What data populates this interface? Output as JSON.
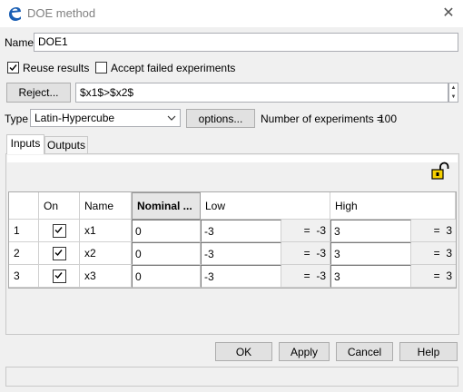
{
  "window": {
    "title": "DOE method",
    "icon": "e-app-icon",
    "close": "close-icon"
  },
  "name_label": "Name",
  "name_value": "DOE1",
  "reuse": {
    "label": "Reuse results",
    "checked": true
  },
  "accept_failed": {
    "label": "Accept failed experiments",
    "checked": false
  },
  "reject_button": "Reject...",
  "reject_expression": "$x1$>$x2$",
  "type_label": "Type",
  "type_value": "Latin-Hypercube",
  "options_button": "options...",
  "num_experiments_label": "Number of experiments =",
  "num_experiments_value": "100",
  "tabs": [
    "Inputs",
    "Outputs"
  ],
  "active_tab": "Inputs",
  "lock_icon": "unlock-icon",
  "table": {
    "headers": {
      "index": "",
      "on": "On",
      "name": "Name",
      "nominal": "Nominal ...",
      "low": "Low",
      "high": "High"
    },
    "rows": [
      {
        "index": "1",
        "on": true,
        "name": "x1",
        "nominal": "0",
        "low": "-3",
        "low_eval": "=  -3",
        "high": "3",
        "high_eval": "=  3"
      },
      {
        "index": "2",
        "on": true,
        "name": "x2",
        "nominal": "0",
        "low": "-3",
        "low_eval": "=  -3",
        "high": "3",
        "high_eval": "=  3"
      },
      {
        "index": "3",
        "on": true,
        "name": "x3",
        "nominal": "0",
        "low": "-3",
        "low_eval": "=  -3",
        "high": "3",
        "high_eval": "=  3"
      }
    ]
  },
  "buttons": {
    "ok": "OK",
    "apply": "Apply",
    "cancel": "Cancel",
    "help": "Help"
  },
  "colors": {
    "accent_blue": "#1a5fb4",
    "lock_yellow": "#f5d000"
  }
}
